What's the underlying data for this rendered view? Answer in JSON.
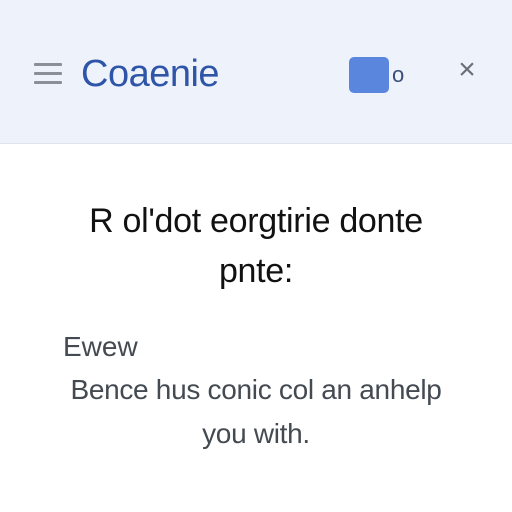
{
  "header": {
    "title": "Coaenie",
    "menu_icon": "hamburger-menu-icon",
    "video_icon": "video-camera-icon",
    "close_icon": "close-icon",
    "lens_glyph": "o",
    "close_glyph": "×"
  },
  "main": {
    "prompt_line1": "R ol'dot eorgtirie donte",
    "prompt_line2": "pnte:"
  },
  "footer": {
    "greeting": "Ewew",
    "message_line1": "Bence hus conic col an anhelp",
    "message_line2": "you with."
  },
  "colors": {
    "header_bg": "#eef2fb",
    "title": "#2f55a8",
    "video_icon": "#5a86de",
    "body_text": "#111111",
    "secondary_text": "#444a52"
  }
}
